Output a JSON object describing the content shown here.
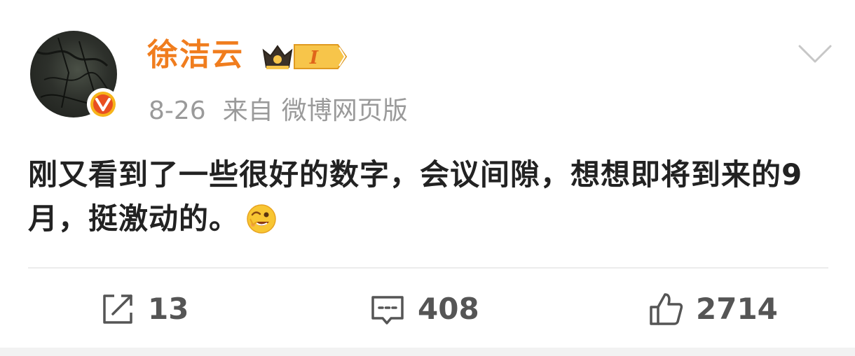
{
  "post": {
    "author": "徐洁云",
    "vip_level": "I",
    "date": "8-26",
    "from_label": "来自",
    "source": "微博网页版",
    "text": "刚又看到了一些很好的数字，会议间隙，想想即将到来的9月，挺激动的。",
    "emoji": "grin-wink-emoji"
  },
  "actions": {
    "repost_count": "13",
    "comment_count": "408",
    "like_count": "2714"
  },
  "colors": {
    "username": "#f07d1e",
    "meta": "#9a9a9a",
    "text": "#222222",
    "action_text": "#555555",
    "verified_badge": "#f6b41a"
  }
}
